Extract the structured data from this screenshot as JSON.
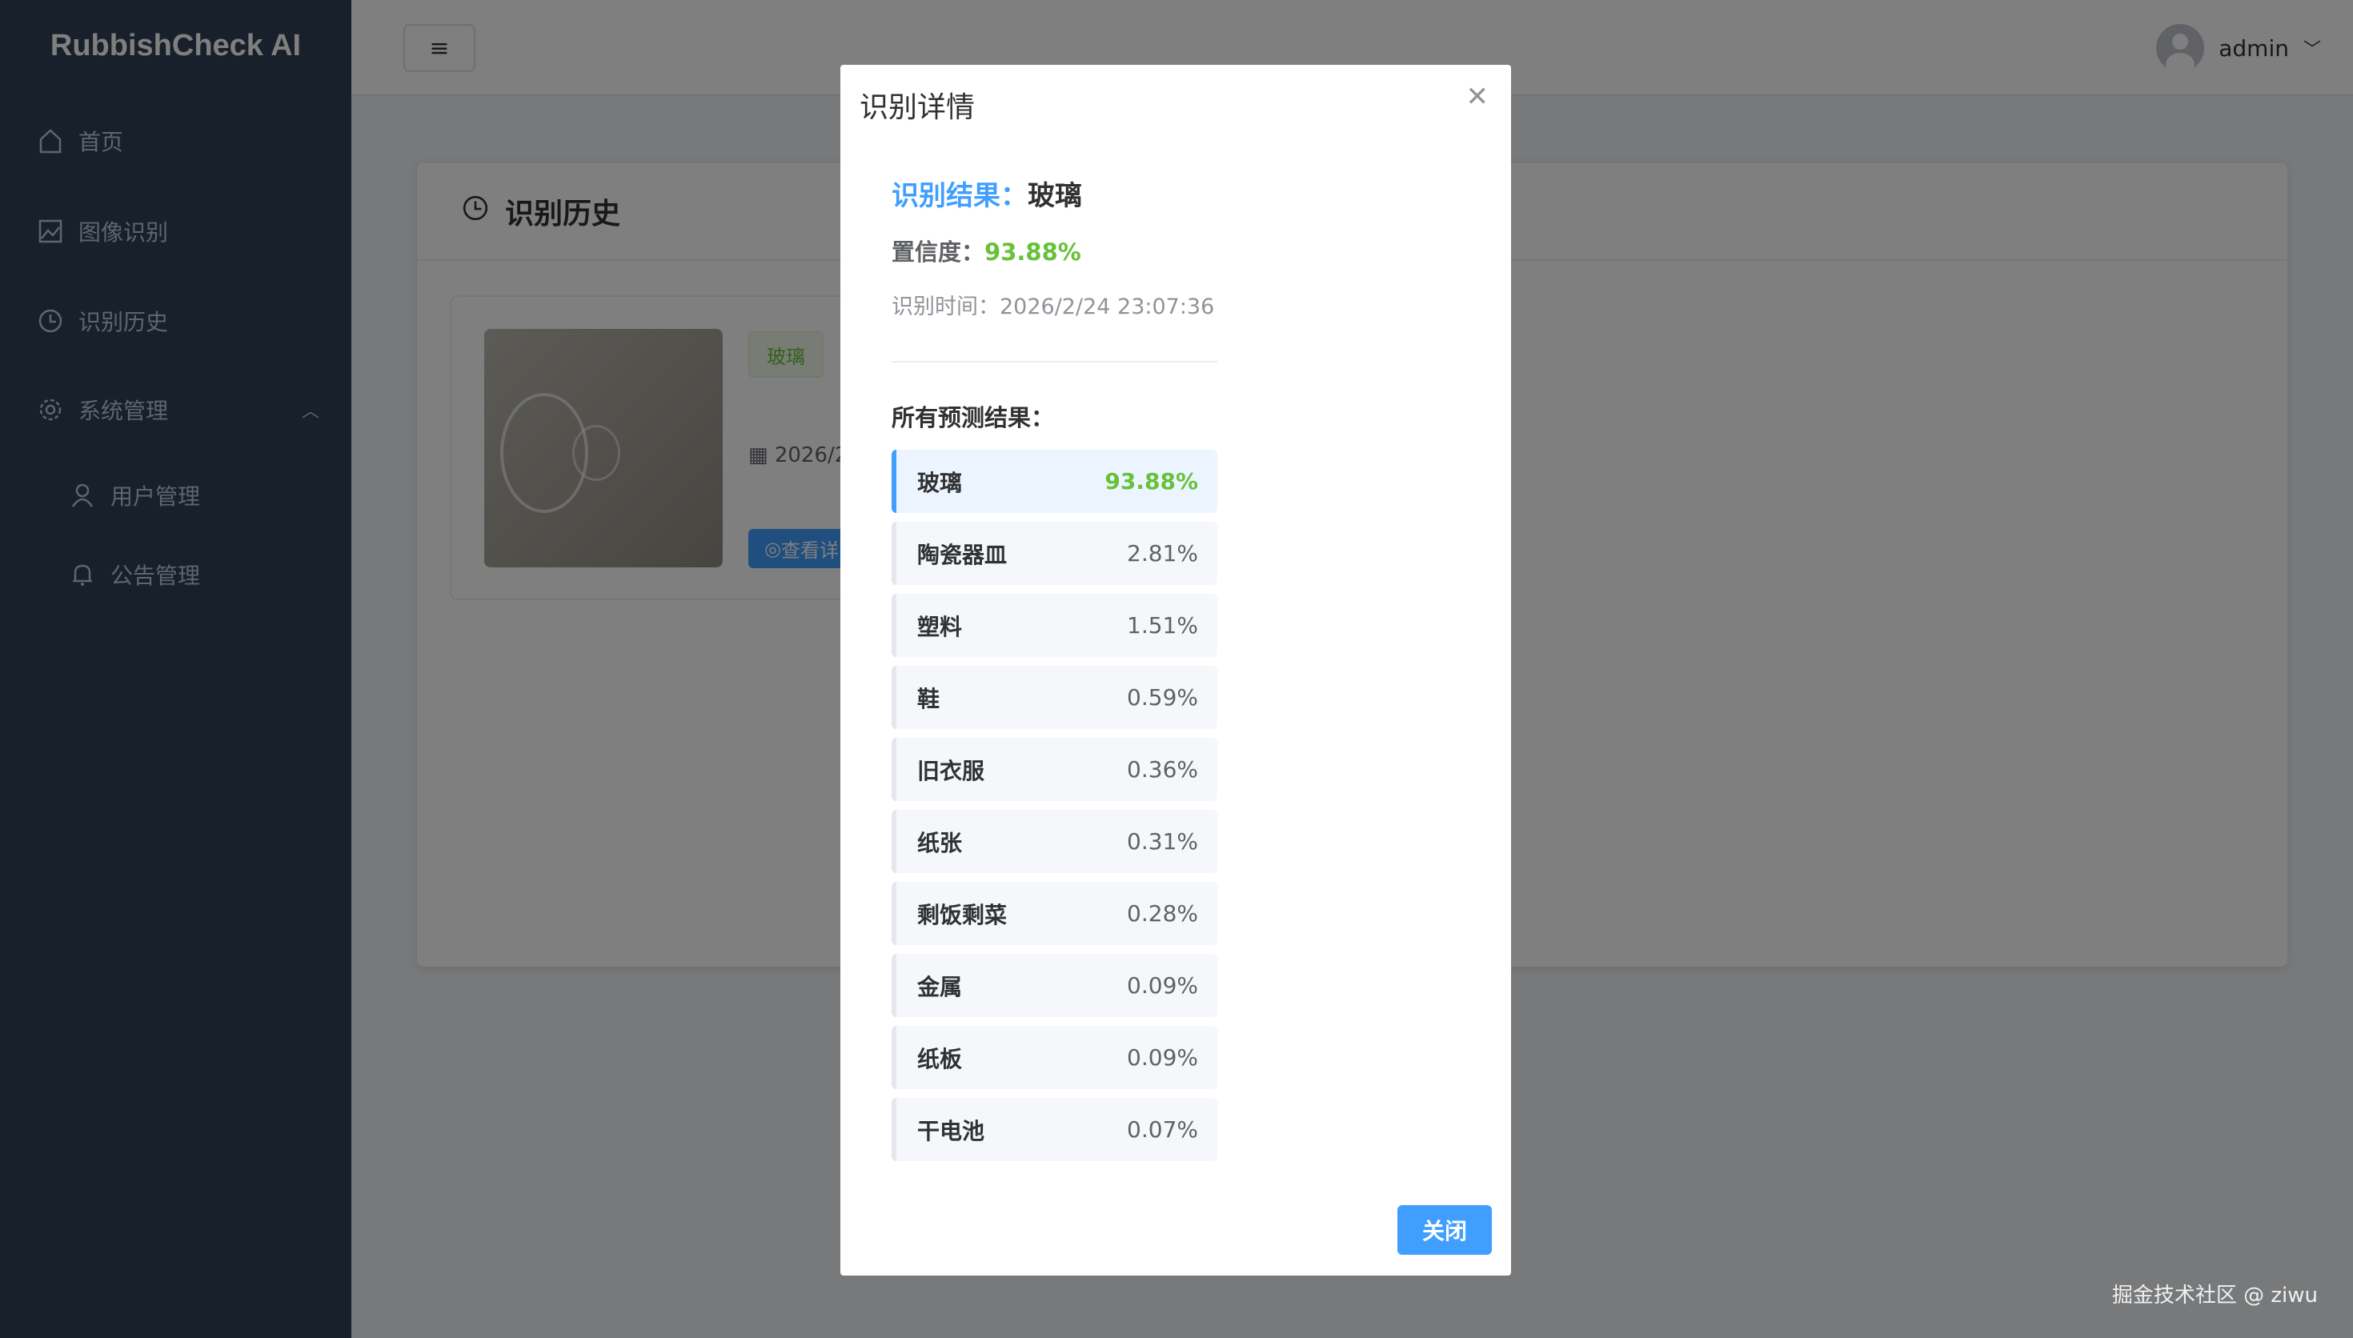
{
  "sidebar": {
    "logo": "RubbishCheck AI",
    "items": [
      {
        "label": "首页",
        "icon": "home-icon"
      },
      {
        "label": "图像识别",
        "icon": "image-icon"
      },
      {
        "label": "识别历史",
        "icon": "clock-icon"
      },
      {
        "label": "系统管理",
        "icon": "gear-icon"
      }
    ],
    "sub_items": [
      {
        "label": "用户管理",
        "icon": "user-icon"
      },
      {
        "label": "公告管理",
        "icon": "bell-icon"
      }
    ]
  },
  "header": {
    "username": "admin"
  },
  "page": {
    "title": "识别历史",
    "item": {
      "tag": "玻璃",
      "date": "2026/2",
      "view_button": "查看详"
    }
  },
  "modal": {
    "title": "识别详情",
    "result_label": "识别结果：",
    "result_value": "玻璃",
    "confidence_label": "置信度：",
    "confidence_value": "93.88%",
    "time_label": "识别时间：",
    "time_value": "2026/2/24 23:07:36",
    "all_label": "所有预测结果：",
    "predictions": [
      {
        "name": "玻璃",
        "pct": "93.88%"
      },
      {
        "name": "陶瓷器皿",
        "pct": "2.81%"
      },
      {
        "name": "塑料",
        "pct": "1.51%"
      },
      {
        "name": "鞋",
        "pct": "0.59%"
      },
      {
        "name": "旧衣服",
        "pct": "0.36%"
      },
      {
        "name": "纸张",
        "pct": "0.31%"
      },
      {
        "name": "剩饭剩菜",
        "pct": "0.28%"
      },
      {
        "name": "金属",
        "pct": "0.09%"
      },
      {
        "name": "纸板",
        "pct": "0.09%"
      },
      {
        "name": "干电池",
        "pct": "0.07%"
      }
    ],
    "close_button": "关闭"
  },
  "watermark": "掘金技术社区 @ ziwu",
  "colors": {
    "primary": "#409eff",
    "success": "#67c23a",
    "sidebar": "#304156"
  }
}
